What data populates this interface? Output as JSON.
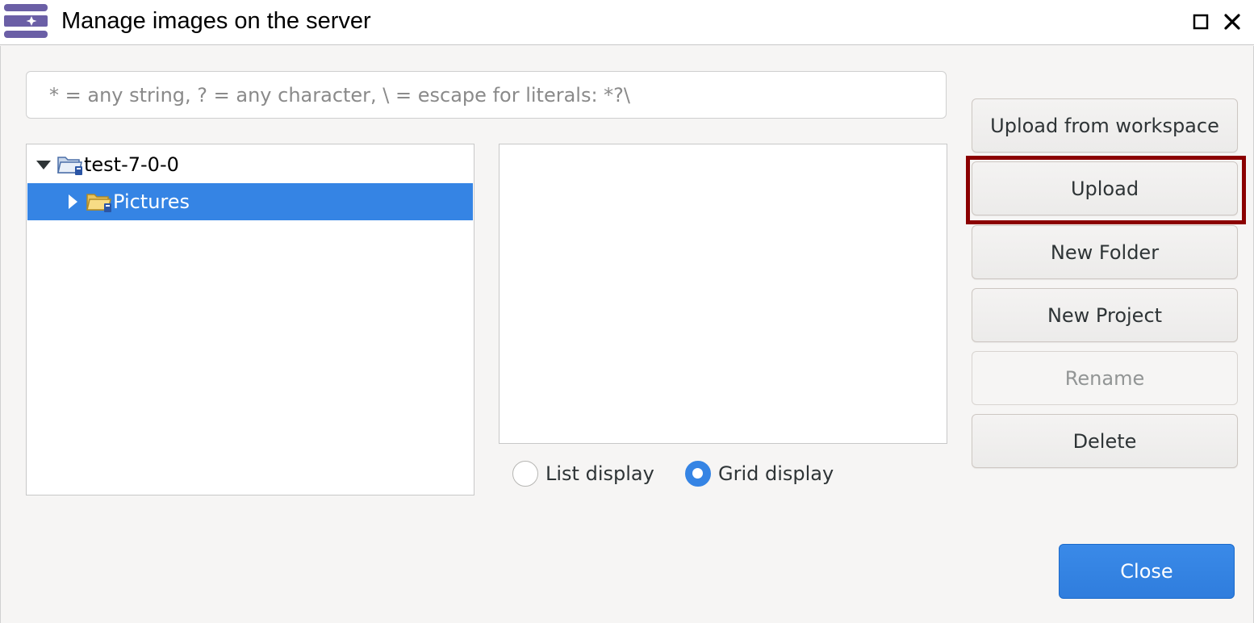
{
  "window": {
    "title": "Manage images on the server",
    "icon": "app-logo-icon",
    "controls": [
      "maximize-icon",
      "close-icon"
    ]
  },
  "filter": {
    "placeholder": "* = any string, ? = any character, \\ = escape for literals: *?\\",
    "value": ""
  },
  "tree": {
    "root": {
      "label": "test-7-0-0",
      "expanded": true,
      "icon": "project-folder-icon"
    },
    "children": [
      {
        "label": "Pictures",
        "expanded": false,
        "selected": true,
        "icon": "folder-icon"
      }
    ]
  },
  "display": {
    "list_label": "List display",
    "grid_label": "Grid display",
    "selected": "grid"
  },
  "actions": {
    "upload_from_workspace": "Upload from workspace",
    "upload": "Upload",
    "new_folder": "New Folder",
    "new_project": "New Project",
    "rename": "Rename",
    "delete": "Delete"
  },
  "footer": {
    "close_label": "Close"
  },
  "colors": {
    "accent": "#3584e4",
    "highlight": "#8b0000",
    "disabled_text": "#929595"
  }
}
